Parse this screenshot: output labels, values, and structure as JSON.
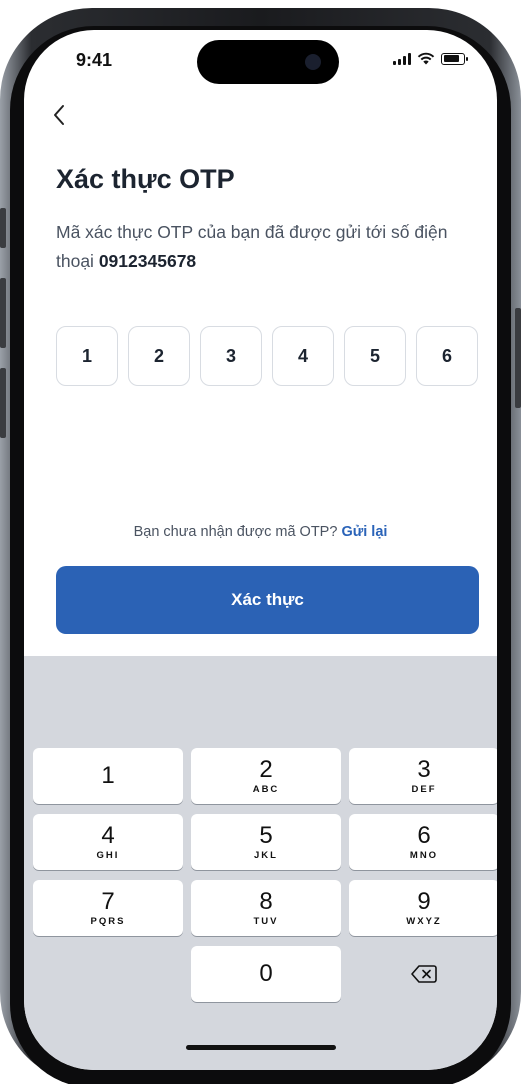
{
  "status_bar": {
    "time": "9:41"
  },
  "header": {
    "back_icon": "chevron-left-icon"
  },
  "content": {
    "title": "Xác thực OTP",
    "description_prefix": "Mã xác thực OTP của bạn đã được gửi tới số điện thoại",
    "phone_number": "0912345678",
    "otp_digits": [
      "1",
      "2",
      "3",
      "4",
      "5",
      "6"
    ],
    "resend_prompt": "Bạn chưa nhận được mã OTP?",
    "resend_link": "Gửi lại",
    "verify_button": "Xác thực"
  },
  "keypad": {
    "keys": [
      {
        "digit": "1",
        "letters": ""
      },
      {
        "digit": "2",
        "letters": "ABC"
      },
      {
        "digit": "3",
        "letters": "DEF"
      },
      {
        "digit": "4",
        "letters": "GHI"
      },
      {
        "digit": "5",
        "letters": "JKL"
      },
      {
        "digit": "6",
        "letters": "MNO"
      },
      {
        "digit": "7",
        "letters": "PQRS"
      },
      {
        "digit": "8",
        "letters": "TUV"
      },
      {
        "digit": "9",
        "letters": "WXYZ"
      },
      {
        "digit": "0",
        "letters": ""
      }
    ],
    "delete_icon": "backspace-icon"
  },
  "colors": {
    "primary": "#2b62b5",
    "link": "#2a63b8",
    "keypad_bg": "#d4d7dd"
  }
}
